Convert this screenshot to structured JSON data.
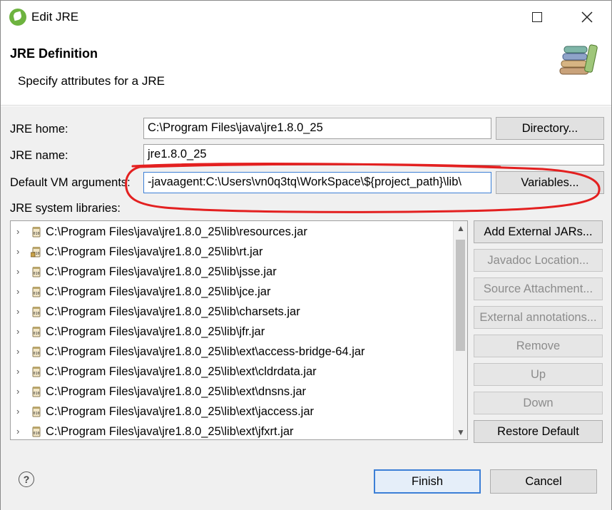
{
  "window": {
    "title": "Edit JRE",
    "maximize_icon": "maximize-icon",
    "close_icon": "close-icon"
  },
  "header": {
    "title": "JRE Definition",
    "subtitle": "Specify attributes for a JRE",
    "banner_icon": "books-icon"
  },
  "form": {
    "jre_home_label": "JRE home:",
    "jre_home_value": "C:\\Program Files\\java\\jre1.8.0_25",
    "directory_button": "Directory...",
    "jre_name_label": "JRE name:",
    "jre_name_value": "jre1.8.0_25",
    "vm_args_label": "Default VM arguments:",
    "vm_args_value": "-javaagent:C:\\Users\\vn0q3tq\\WorkSpace\\${project_path}\\lib\\",
    "variables_button": "Variables...",
    "libraries_label": "JRE system libraries:"
  },
  "libraries": [
    {
      "label": "C:\\Program Files\\java\\jre1.8.0_25\\lib\\resources.jar",
      "icon": "jar-icon"
    },
    {
      "label": "C:\\Program Files\\java\\jre1.8.0_25\\lib\\rt.jar",
      "icon": "jar-source-icon"
    },
    {
      "label": "C:\\Program Files\\java\\jre1.8.0_25\\lib\\jsse.jar",
      "icon": "jar-icon"
    },
    {
      "label": "C:\\Program Files\\java\\jre1.8.0_25\\lib\\jce.jar",
      "icon": "jar-icon"
    },
    {
      "label": "C:\\Program Files\\java\\jre1.8.0_25\\lib\\charsets.jar",
      "icon": "jar-icon"
    },
    {
      "label": "C:\\Program Files\\java\\jre1.8.0_25\\lib\\jfr.jar",
      "icon": "jar-icon"
    },
    {
      "label": "C:\\Program Files\\java\\jre1.8.0_25\\lib\\ext\\access-bridge-64.jar",
      "icon": "jar-icon"
    },
    {
      "label": "C:\\Program Files\\java\\jre1.8.0_25\\lib\\ext\\cldrdata.jar",
      "icon": "jar-icon"
    },
    {
      "label": "C:\\Program Files\\java\\jre1.8.0_25\\lib\\ext\\dnsns.jar",
      "icon": "jar-icon"
    },
    {
      "label": "C:\\Program Files\\java\\jre1.8.0_25\\lib\\ext\\jaccess.jar",
      "icon": "jar-icon"
    },
    {
      "label": "C:\\Program Files\\java\\jre1.8.0_25\\lib\\ext\\jfxrt.jar",
      "icon": "jar-icon"
    }
  ],
  "side_buttons": {
    "add_external_jars": "Add External JARs...",
    "javadoc_location": "Javadoc Location...",
    "source_attachment": "Source Attachment...",
    "external_annotations": "External annotations...",
    "remove": "Remove",
    "up": "Up",
    "down": "Down",
    "restore_default": "Restore Default"
  },
  "footer": {
    "help_icon": "help-icon",
    "finish": "Finish",
    "cancel": "Cancel"
  },
  "colors": {
    "annotation_stroke": "#e32020",
    "primary_button_border": "#3c7fd6"
  }
}
